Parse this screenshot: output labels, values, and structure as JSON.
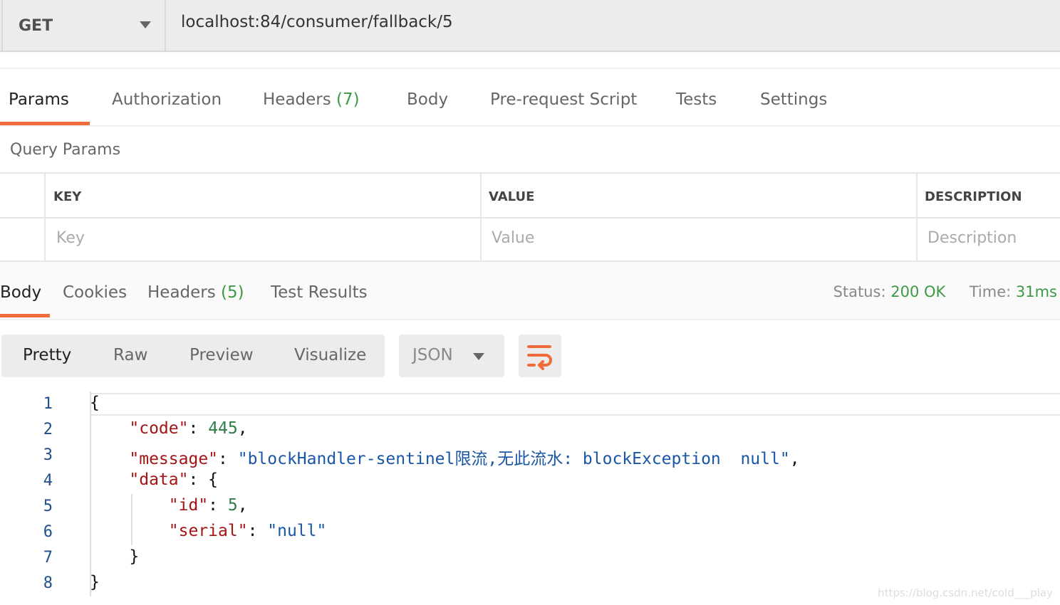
{
  "request": {
    "method": "GET",
    "url": "localhost:84/consumer/fallback/5"
  },
  "request_tabs": [
    {
      "label": "Params",
      "active": true
    },
    {
      "label": "Authorization"
    },
    {
      "label": "Headers",
      "count": "(7)"
    },
    {
      "label": "Body"
    },
    {
      "label": "Pre-request Script"
    },
    {
      "label": "Tests"
    },
    {
      "label": "Settings"
    }
  ],
  "query_params": {
    "title": "Query Params",
    "columns": [
      "KEY",
      "VALUE",
      "DESCRIPTION"
    ],
    "placeholders": [
      "Key",
      "Value",
      "Description"
    ]
  },
  "response_tabs": [
    {
      "label": "Body",
      "active": true
    },
    {
      "label": "Cookies"
    },
    {
      "label": "Headers",
      "count": "(5)"
    },
    {
      "label": "Test Results"
    }
  ],
  "status": {
    "status_label": "Status:",
    "status_value": "200 OK",
    "time_label": "Time:",
    "time_value": "31ms"
  },
  "view_modes": [
    "Pretty",
    "Raw",
    "Preview",
    "Visualize"
  ],
  "format": "JSON",
  "accent_color": "#f26b3a",
  "code_lines": [
    "1",
    "2",
    "3",
    "4",
    "5",
    "6",
    "7",
    "8"
  ],
  "json": {
    "code_key": "\"code\"",
    "code_val": "445",
    "message_key": "\"message\"",
    "message_val": "\"blockHandler-sentinel限流,无此流水: blockException  null\"",
    "data_key": "\"data\"",
    "id_key": "\"id\"",
    "id_val": "5",
    "serial_key": "\"serial\"",
    "serial_val": "\"null\""
  },
  "watermark": "https://blog.csdn.net/cold___play"
}
